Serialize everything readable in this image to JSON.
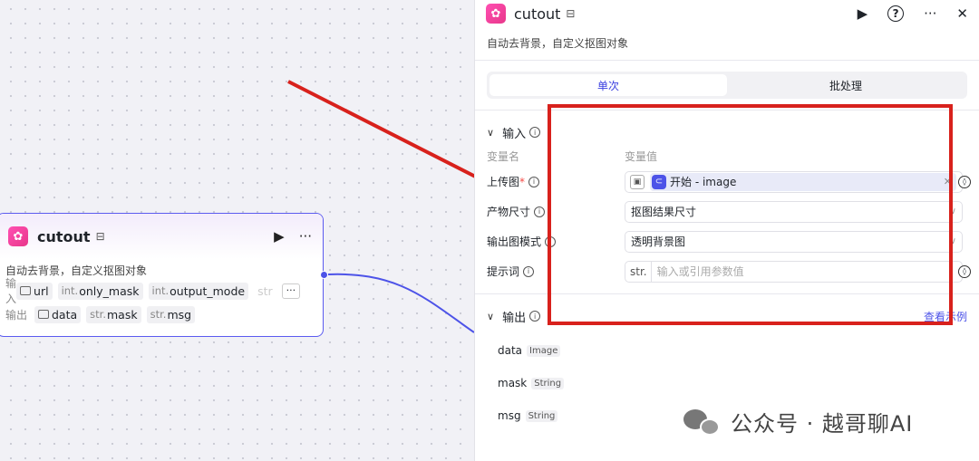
{
  "node": {
    "title": "cutout",
    "description": "自动去背景，自定义抠图对象",
    "input_label": "输入",
    "output_label": "输出",
    "inputs": [
      {
        "type": "",
        "name": "url"
      },
      {
        "type": "int.",
        "name": "only_mask"
      },
      {
        "type": "int.",
        "name": "output_mode"
      },
      {
        "type": "",
        "name": "str"
      }
    ],
    "more_label": "···",
    "outputs": [
      {
        "type": "",
        "name": "data"
      },
      {
        "type": "str.",
        "name": "mask"
      },
      {
        "type": "str.",
        "name": "msg"
      }
    ]
  },
  "panel": {
    "title": "cutout",
    "description": "自动去背景，自定义抠图对象",
    "help_label": "?",
    "more_label": "···",
    "close_label": "✕",
    "tabs": [
      {
        "label": "单次",
        "active": true
      },
      {
        "label": "批处理",
        "active": false
      }
    ],
    "input_section": {
      "title": "输入",
      "col_name": "变量名",
      "col_value": "变量值",
      "params": [
        {
          "name": "上传图",
          "required": "*",
          "value_ref": "开始 - image"
        },
        {
          "name": "产物尺寸",
          "value": "抠图结果尺寸"
        },
        {
          "name": "输出图模式",
          "value": "透明背景图"
        },
        {
          "name": "提示词",
          "prefix": "str.",
          "placeholder": "输入或引用参数值"
        }
      ]
    },
    "output_section": {
      "title": "输出",
      "example_link": "查看示例",
      "outputs": [
        {
          "name": "data",
          "type": "Image"
        },
        {
          "name": "mask",
          "type": "String"
        },
        {
          "name": "msg",
          "type": "String"
        }
      ]
    }
  },
  "watermark": "公众号 · 越哥聊AI",
  "colors": {
    "accent": "#4d53e8",
    "annotation_red": "#d8211c",
    "app_icon": "#e8378a"
  }
}
